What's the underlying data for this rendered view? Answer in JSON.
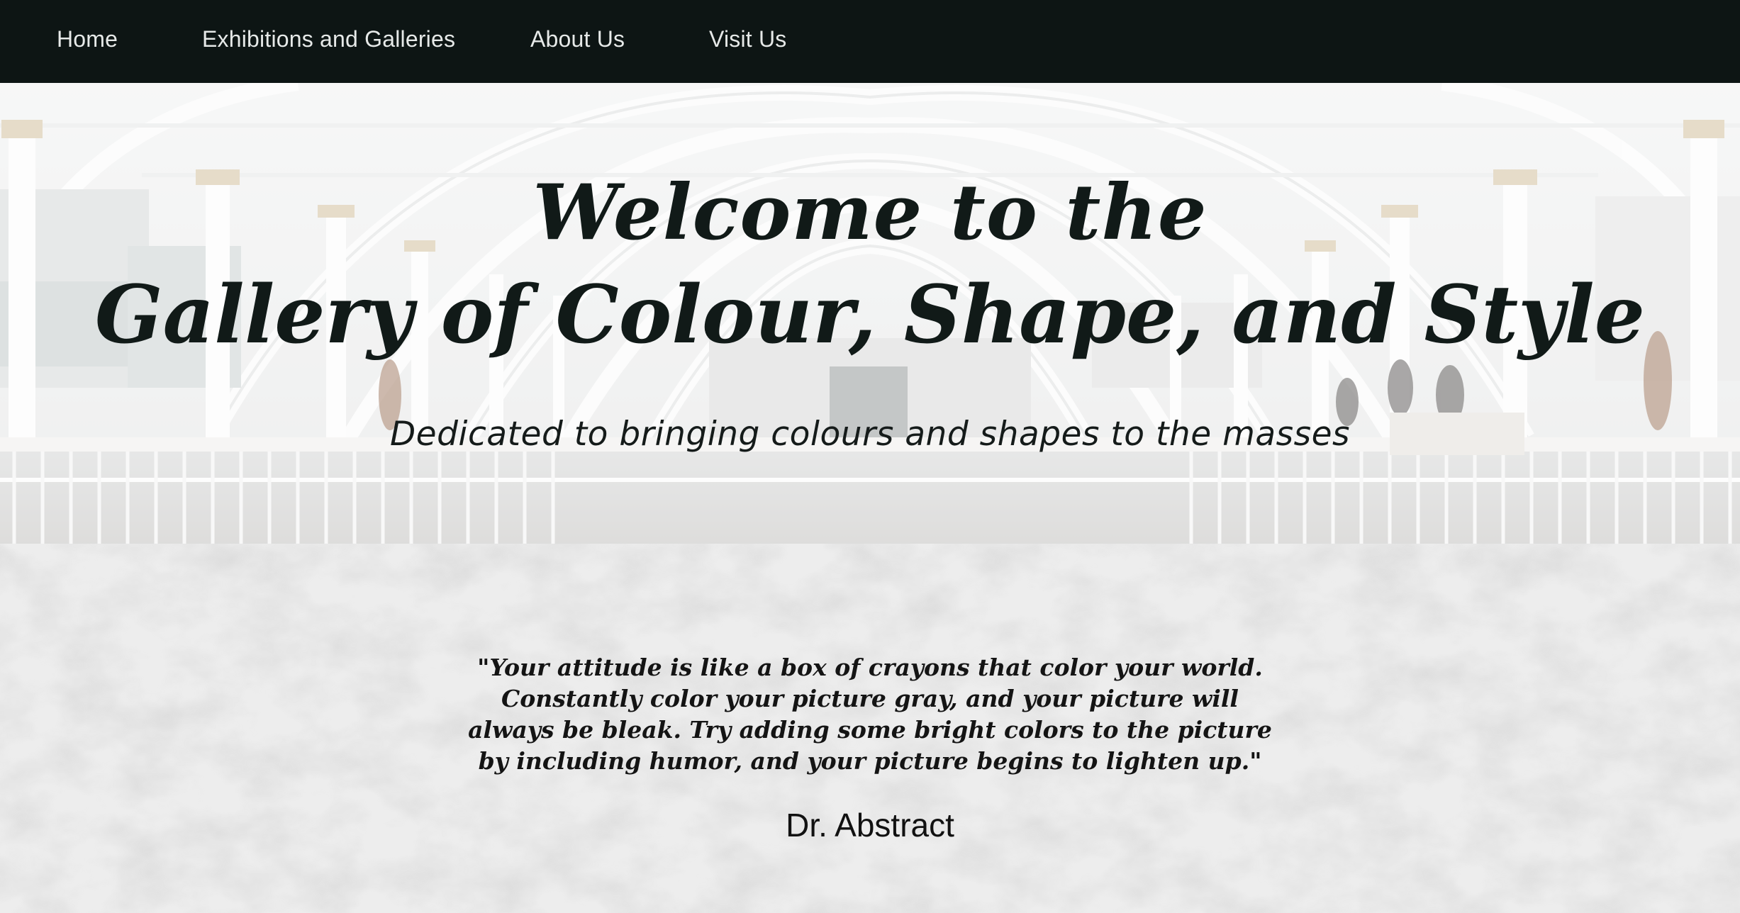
{
  "nav": {
    "items": [
      {
        "label": "Home"
      },
      {
        "label": "Exhibitions and Galleries"
      },
      {
        "label": "About Us"
      },
      {
        "label": "Visit Us"
      }
    ]
  },
  "hero": {
    "title_line1": "Welcome to the",
    "title_line2": "Gallery of Colour, Shape, and Style",
    "tagline": "Dedicated to bringing colours and shapes to the masses"
  },
  "quote": {
    "lines": [
      "\"Your attitude is like a box of crayons that color your world.",
      "Constantly color your picture gray, and your picture will",
      "always be bleak. Try adding some bright colors to the picture",
      "by including humor, and your picture begins to lighten up.\""
    ],
    "author": "Dr. Abstract"
  },
  "colors": {
    "nav_bg": "#0d1514",
    "nav_text": "#e6e9e8",
    "title_text": "#111a18"
  }
}
